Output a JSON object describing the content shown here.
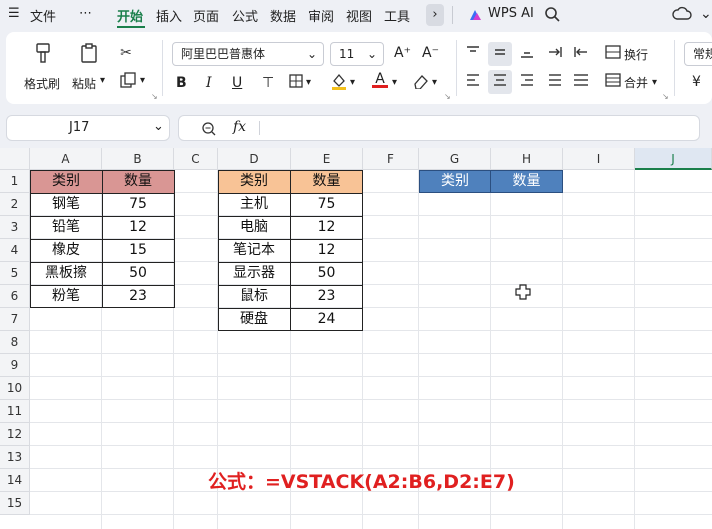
{
  "menu": {
    "items": [
      "文件",
      "⋯",
      "开始",
      "插入",
      "页面",
      "公式",
      "数据",
      "审阅",
      "视图",
      "工具"
    ],
    "active": "开始",
    "wps_ai": "WPS AI"
  },
  "ribbon": {
    "format_painter": "格式刷",
    "paste": "粘贴",
    "font_name": "阿里巴巴普惠体",
    "font_size": "11",
    "wrap": "换行",
    "merge": "合并",
    "number_format": "常规",
    "bold": "B",
    "italic": "I",
    "underline": "U",
    "font_color_letter": "A",
    "grow_font": "A⁺",
    "shrink_font": "A⁻",
    "currency": "¥"
  },
  "formula_bar": {
    "cell_ref": "J17",
    "fx": "fx",
    "content": ""
  },
  "grid": {
    "columns": [
      "A",
      "B",
      "C",
      "D",
      "E",
      "F",
      "G",
      "H",
      "I",
      "J"
    ],
    "selected_column": "J",
    "rows": [
      "1",
      "2",
      "3",
      "4",
      "5",
      "6",
      "7",
      "8",
      "9",
      "10",
      "11",
      "12",
      "13",
      "14",
      "15"
    ]
  },
  "colors": {
    "table1_header": "#d99694",
    "table2_header": "#f8c396",
    "table3_header": "#4f81bd",
    "formula_text": "#e02020",
    "accent": "#1a7f4b"
  },
  "table1": {
    "headers": [
      "类别",
      "数量"
    ],
    "rows": [
      [
        "钢笔",
        "75"
      ],
      [
        "铅笔",
        "12"
      ],
      [
        "橡皮",
        "15"
      ],
      [
        "黑板擦",
        "50"
      ],
      [
        "粉笔",
        "23"
      ]
    ]
  },
  "table2": {
    "headers": [
      "类别",
      "数量"
    ],
    "rows": [
      [
        "主机",
        "75"
      ],
      [
        "电脑",
        "12"
      ],
      [
        "笔记本",
        "12"
      ],
      [
        "显示器",
        "50"
      ],
      [
        "鼠标",
        "23"
      ],
      [
        "硬盘",
        "24"
      ]
    ]
  },
  "table3": {
    "headers": [
      "类别",
      "数量"
    ]
  },
  "annotation": "公式：=VSTACK(A2:B6,D2:E7)"
}
